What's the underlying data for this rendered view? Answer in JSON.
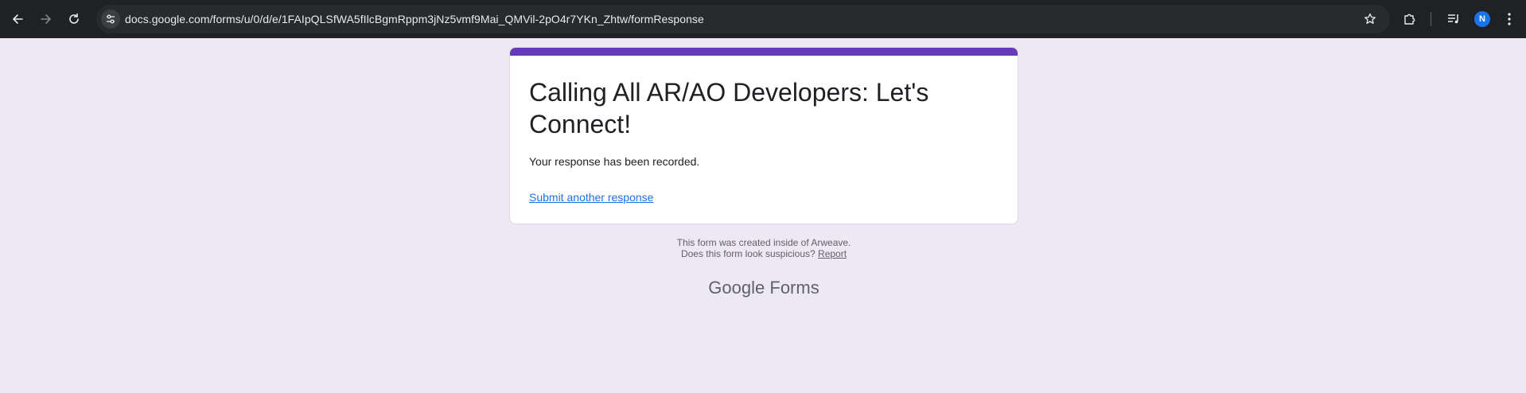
{
  "browser": {
    "url": "docs.google.com/forms/u/0/d/e/1FAIpQLSfWA5fIlcBgmRppm3jNz5vmf9Mai_QMVil-2pO4r7YKn_Zhtw/formResponse",
    "profile_initial": "N",
    "icons": {
      "back": "arrow-left-icon",
      "forward": "arrow-right-icon",
      "reload": "reload-icon",
      "site_info": "tune-icon",
      "bookmark": "star-icon",
      "extensions": "puzzle-icon",
      "media": "media-control-icon",
      "menu": "more-vert-icon"
    }
  },
  "form": {
    "title": "Calling All AR/AO Developers: Let's Connect!",
    "message": "Your response has been recorded.",
    "submit_another": "Submit another response",
    "accent_color": "#673ab7"
  },
  "footer": {
    "created_note": "This form was created inside of Arweave.",
    "suspicious_question": "Does this form look suspicious?",
    "report_label": "Report",
    "brand_google": "Google",
    "brand_forms": "Forms"
  },
  "colors": {
    "page_background": "#ede7f6",
    "toolbar_background": "#202124",
    "link": "#1a73e8"
  }
}
